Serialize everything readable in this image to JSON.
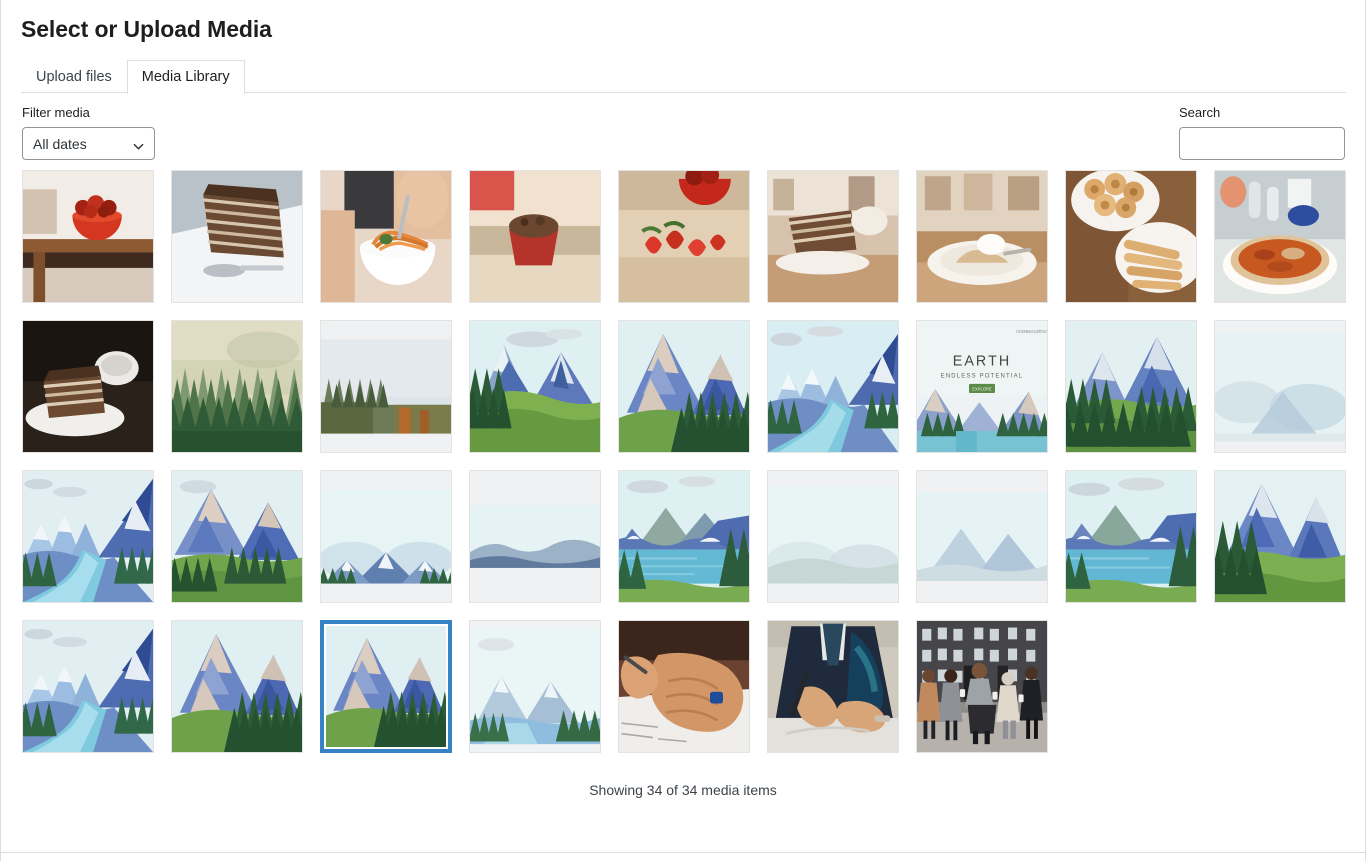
{
  "modal": {
    "title": "Select or Upload Media"
  },
  "tabs": [
    {
      "id": "upload-files",
      "label": "Upload files",
      "active": false
    },
    {
      "id": "media-library",
      "label": "Media Library",
      "active": true
    }
  ],
  "toolbar": {
    "filter": {
      "label": "Filter media",
      "selected": "All dates",
      "options": [
        "All dates"
      ],
      "icon": "chevron-down-icon"
    },
    "search": {
      "label": "Search",
      "value": "",
      "placeholder": ""
    }
  },
  "colors": {
    "accent_selected": "#3582c4",
    "border": "#dddddd",
    "field_border": "#949494",
    "text": "#1e1e1e",
    "muted_text": "#3c434a",
    "thumb_bg": "#f6f7f7"
  },
  "grid": {
    "columns": 9,
    "items": [
      {
        "id": 1,
        "kind": "photo-food-bowl",
        "alt": "Red bowl of strawberries on wooden table",
        "selected": false
      },
      {
        "id": 2,
        "kind": "photo-cake-slice",
        "alt": "Slice of layered chocolate cake with spoon",
        "selected": false
      },
      {
        "id": 3,
        "kind": "photo-noodle-bowl",
        "alt": "Hand holding white bowl of noodles and salad",
        "selected": false
      },
      {
        "id": 4,
        "kind": "photo-muffin",
        "alt": "Chocolate muffin in red wrapper on table",
        "selected": false
      },
      {
        "id": 5,
        "kind": "photo-strawberries",
        "alt": "Strawberries and red bowl on wooden board",
        "selected": false
      },
      {
        "id": 6,
        "kind": "photo-cake-plate",
        "alt": "Layered cake slice on plate in cafe",
        "selected": false
      },
      {
        "id": 7,
        "kind": "photo-dessert-cream",
        "alt": "Dessert with whipped cream on white plate",
        "selected": false
      },
      {
        "id": 8,
        "kind": "photo-pastries",
        "alt": "Plates of swirl pastries and fried snacks",
        "selected": false
      },
      {
        "id": 9,
        "kind": "photo-pizza",
        "alt": "Pizza on white plate with drinks behind",
        "selected": false
      },
      {
        "id": 10,
        "kind": "photo-cake-dark",
        "alt": "Layered cake slice with coffee cup, dark table",
        "selected": false
      },
      {
        "id": 11,
        "kind": "photo-misty-forest",
        "alt": "Misty evergreen forest photograph",
        "selected": false
      },
      {
        "id": 12,
        "kind": "photo-autumn-treeline",
        "alt": "Autumn treeline under pale sky, letterboxed",
        "selected": false
      },
      {
        "id": 13,
        "kind": "illus-peaks-meadow",
        "alt": "Illustrated blue mountain peaks over green meadow",
        "selected": false
      },
      {
        "id": 14,
        "kind": "illus-twin-peaks",
        "alt": "Illustrated twin mountains with pine forest",
        "selected": false
      },
      {
        "id": 15,
        "kind": "illus-river-valley",
        "alt": "Illustrated river running through blue valley",
        "selected": false
      },
      {
        "id": 16,
        "kind": "illus-earth-hero",
        "alt": "Website hero mockup with mountains and lake",
        "selected": false,
        "overlay": {
          "nav": [
            "HOME",
            "ABOUT",
            "CONTACT"
          ],
          "heading": "EARTH",
          "subheading": "ENDLESS POTENTIAL",
          "button": "EXPLORE",
          "button_color": "#5d8b4a"
        }
      },
      {
        "id": 17,
        "kind": "illus-peaks-pines",
        "alt": "Illustrated peaks with pines and green hills",
        "selected": false
      },
      {
        "id": 18,
        "kind": "illus-pale-haze",
        "alt": "Pale illustrated mountain haze, light blue",
        "selected": false
      },
      {
        "id": 19,
        "kind": "illus-river-left",
        "alt": "Illustrated river with snow peaks and pines",
        "selected": false
      },
      {
        "id": 20,
        "kind": "illus-blue-range",
        "alt": "Illustrated blue mountain range over meadow",
        "selected": false
      },
      {
        "id": 21,
        "kind": "illus-wide-pale-peaks",
        "alt": "Wide pale mountains, letterboxed panorama",
        "selected": false
      },
      {
        "id": 22,
        "kind": "illus-wide-ridge",
        "alt": "Wide distant ridge panorama, letterboxed",
        "selected": false
      },
      {
        "id": 23,
        "kind": "illus-lake-pines",
        "alt": "Illustrated lake with pines and mountains",
        "selected": false
      },
      {
        "id": 24,
        "kind": "illus-wide-pale-hills",
        "alt": "Wide pale hills panorama, letterboxed",
        "selected": false
      },
      {
        "id": 25,
        "kind": "illus-wide-soft-peaks",
        "alt": "Wide soft blue peaks panorama, letterboxed",
        "selected": false
      },
      {
        "id": 26,
        "kind": "illus-lake-panorama",
        "alt": "Illustrated lake panorama with clouds",
        "selected": false
      },
      {
        "id": 27,
        "kind": "illus-tall-peaks",
        "alt": "Illustrated tall peaks with pine foreground",
        "selected": false
      },
      {
        "id": 28,
        "kind": "illus-river-left",
        "alt": "Illustrated river valley with snow peaks",
        "selected": false
      },
      {
        "id": 29,
        "kind": "illus-twin-peaks",
        "alt": "Illustrated twin peaks with pine forest",
        "selected": false
      },
      {
        "id": 30,
        "kind": "illus-twin-peaks",
        "alt": "Illustrated twin peaks, currently selected",
        "selected": true
      },
      {
        "id": 31,
        "kind": "illus-pale-valley",
        "alt": "Pale illustrated valley with pines",
        "selected": false
      },
      {
        "id": 32,
        "kind": "photo-hands-signing",
        "alt": "Elderly hands signing a paper document",
        "selected": false
      },
      {
        "id": 33,
        "kind": "photo-businessman",
        "alt": "Businessman in suit signing a document",
        "selected": false
      },
      {
        "id": 34,
        "kind": "photo-people-street",
        "alt": "Group of people walking in front of building",
        "selected": false
      }
    ]
  },
  "footer": {
    "count_text": "Showing 34 of 34 media items"
  }
}
